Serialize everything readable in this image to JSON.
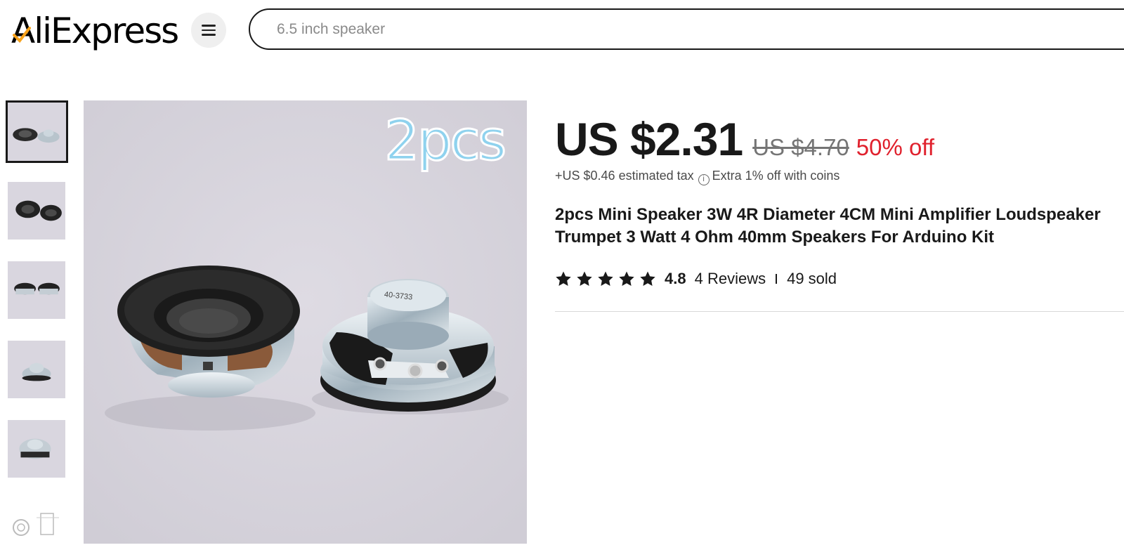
{
  "header": {
    "logo": "AliExpress",
    "search": {
      "value": "",
      "placeholder": "6.5 inch speaker"
    }
  },
  "gallery": {
    "thumbnails": [
      {
        "label": "thumb-1",
        "selected": true
      },
      {
        "label": "thumb-2",
        "selected": false
      },
      {
        "label": "thumb-3",
        "selected": false
      },
      {
        "label": "thumb-4",
        "selected": false
      },
      {
        "label": "thumb-5",
        "selected": false
      },
      {
        "label": "thumb-6",
        "selected": false
      }
    ],
    "main_overlay_text": "2pcs"
  },
  "product": {
    "price": "US $2.31",
    "original_price": "US $4.70",
    "discount": "50% off",
    "tax": "+US $0.46 estimated tax",
    "coins_note": "Extra 1% off with coins",
    "title": "2pcs Mini Speaker 3W 4R Diameter 4CM Mini Amplifier Loudspeaker Trumpet 3 Watt 4 Ohm 40mm Speakers For Arduino Kit",
    "rating": "4.8",
    "stars": 5,
    "reviews": "4 Reviews",
    "sold": "49 sold"
  },
  "colors": {
    "discount": "#e0212d",
    "text": "#191919",
    "muted": "#757575"
  }
}
